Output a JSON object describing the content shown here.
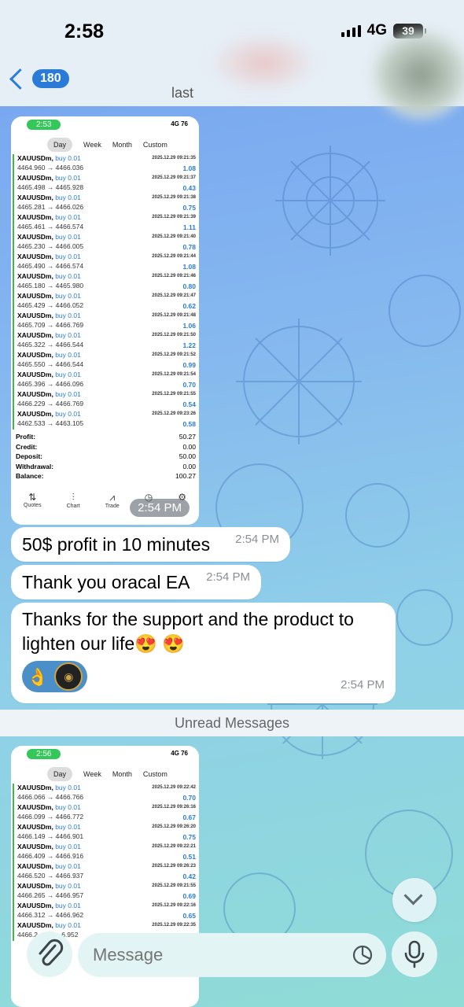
{
  "status_bar": {
    "time": "2:58",
    "network": "4G",
    "battery": "39"
  },
  "header": {
    "back_count": "180",
    "title": "last"
  },
  "shot1": {
    "status_time": "2:53",
    "status_signal": "4G",
    "status_battery": "76",
    "tabs": [
      "Day",
      "Week",
      "Month",
      "Custom"
    ],
    "trades": [
      {
        "sym": "XAUUSDm,",
        "side": "buy 0.01",
        "date": "2025.12.29 09:21:35",
        "prices": "4464.960 → 4466.036",
        "pnl": "1.08"
      },
      {
        "sym": "XAUUSDm,",
        "side": "buy 0.01",
        "date": "2025.12.29 09:21:37",
        "prices": "4465.498 → 4465.928",
        "pnl": "0.43"
      },
      {
        "sym": "XAUUSDm,",
        "side": "buy 0.01",
        "date": "2025.12.29 09:21:38",
        "prices": "4465.281 → 4466.026",
        "pnl": "0.75"
      },
      {
        "sym": "XAUUSDm,",
        "side": "buy 0.01",
        "date": "2025.12.29 09:21:39",
        "prices": "4465.461 → 4466.574",
        "pnl": "1.11"
      },
      {
        "sym": "XAUUSDm,",
        "side": "buy 0.01",
        "date": "2025.12.29 09:21:40",
        "prices": "4465.230 → 4466.005",
        "pnl": "0.78"
      },
      {
        "sym": "XAUUSDm,",
        "side": "buy 0.01",
        "date": "2025.12.29 09:21:44",
        "prices": "4465.490 → 4466.574",
        "pnl": "1.08"
      },
      {
        "sym": "XAUUSDm,",
        "side": "buy 0.01",
        "date": "2025.12.29 09:21:46",
        "prices": "4465.180 → 4465.980",
        "pnl": "0.80"
      },
      {
        "sym": "XAUUSDm,",
        "side": "buy 0.01",
        "date": "2025.12.29 09:21:47",
        "prices": "4465.429 → 4466.052",
        "pnl": "0.62"
      },
      {
        "sym": "XAUUSDm,",
        "side": "buy 0.01",
        "date": "2025.12.29 09:21:48",
        "prices": "4465.709 → 4466.769",
        "pnl": "1.06"
      },
      {
        "sym": "XAUUSDm,",
        "side": "buy 0.01",
        "date": "2025.12.29 09:21:50",
        "prices": "4465.322 → 4466.544",
        "pnl": "1.22"
      },
      {
        "sym": "XAUUSDm,",
        "side": "buy 0.01",
        "date": "2025.12.29 09:21:52",
        "prices": "4465.550 → 4466.544",
        "pnl": "0.99"
      },
      {
        "sym": "XAUUSDm,",
        "side": "buy 0.01",
        "date": "2025.12.29 09:21:54",
        "prices": "4465.396 → 4466.096",
        "pnl": "0.70"
      },
      {
        "sym": "XAUUSDm,",
        "side": "buy 0.01",
        "date": "2025.12.29 09:21:55",
        "prices": "4466.229 → 4466.769",
        "pnl": "0.54"
      },
      {
        "sym": "XAUUSDm,",
        "side": "buy 0.01",
        "date": "2025.12.29 09:23:26",
        "prices": "4462.533 → 4463.105",
        "pnl": "0.58"
      }
    ],
    "summary": [
      {
        "label": "Profit:",
        "value": "50.27"
      },
      {
        "label": "Credit:",
        "value": "0.00"
      },
      {
        "label": "Deposit:",
        "value": "50.00"
      },
      {
        "label": "Withdrawal:",
        "value": "0.00"
      },
      {
        "label": "Balance:",
        "value": "100.27"
      }
    ],
    "nav": [
      "Quotes",
      "Chart",
      "Trade",
      "History",
      "Settings"
    ],
    "time": "2:54 PM"
  },
  "messages": [
    {
      "text": "50$ profit in 10 minutes",
      "time": "2:54 PM"
    },
    {
      "text": "Thank you oracal EA",
      "time": "2:54 PM"
    },
    {
      "text": "Thanks for the support and the product to lighten our life😍 😍",
      "time": "2:54 PM",
      "reaction": "👌"
    }
  ],
  "unread_label": "Unread Messages",
  "shot2": {
    "status_time": "2:56",
    "status_signal": "4G",
    "status_battery": "76",
    "tabs": [
      "Day",
      "Week",
      "Month",
      "Custom"
    ],
    "trades": [
      {
        "sym": "XAUUSDm,",
        "side": "buy 0.01",
        "date": "2025.12.29 09:22:42",
        "prices": "4466.066 → 4466.766",
        "pnl": "0.70"
      },
      {
        "sym": "XAUUSDm,",
        "side": "buy 0.01",
        "date": "2025.12.29 09:26:16",
        "prices": "4466.099 → 4466.772",
        "pnl": "0.67"
      },
      {
        "sym": "XAUUSDm,",
        "side": "buy 0.01",
        "date": "2025.12.29 09:26:20",
        "prices": "4466.149 → 4466.901",
        "pnl": "0.75"
      },
      {
        "sym": "XAUUSDm,",
        "side": "buy 0.01",
        "date": "2025.12.29 09:22:21",
        "prices": "4466.409 → 4466.916",
        "pnl": "0.51"
      },
      {
        "sym": "XAUUSDm,",
        "side": "buy 0.01",
        "date": "2025.12.29 09:26:23",
        "prices": "4466.520 → 4466.937",
        "pnl": "0.42"
      },
      {
        "sym": "XAUUSDm,",
        "side": "buy 0.01",
        "date": "2025.12.29 09:21:55",
        "prices": "4466.265 → 4466.957",
        "pnl": "0.69"
      },
      {
        "sym": "XAUUSDm,",
        "side": "buy 0.01",
        "date": "2025.12.29 09:22:16",
        "prices": "4466.312 → 4466.962",
        "pnl": "0.65"
      },
      {
        "sym": "XAUUSDm,",
        "side": "buy 0.01",
        "date": "2025.12.29 09:22:35",
        "prices": "4466.2… → …6.952",
        "pnl": ""
      }
    ]
  },
  "input": {
    "placeholder": "Message"
  }
}
